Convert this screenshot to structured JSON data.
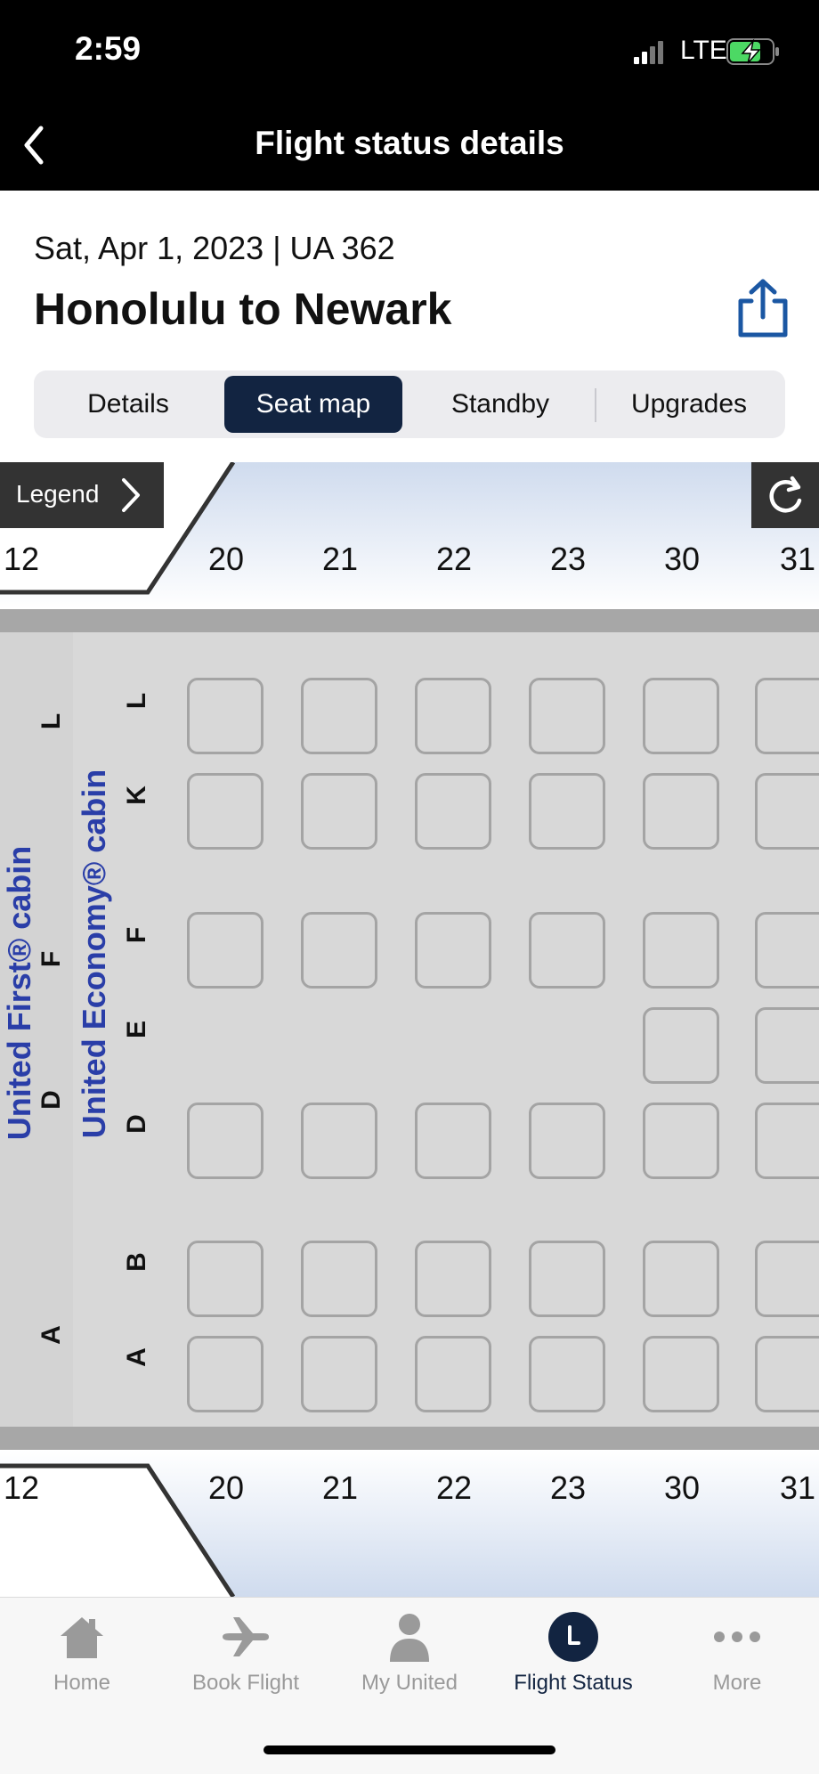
{
  "status_bar": {
    "time": "2:59",
    "network": "LTE"
  },
  "nav": {
    "title": "Flight status details",
    "back_icon": "chevron-left-icon"
  },
  "flight": {
    "date_line": "Sat, Apr 1, 2023 | UA 362",
    "route": "Honolulu to Newark",
    "share_icon": "share-icon"
  },
  "tabs": [
    {
      "label": "Details",
      "active": false
    },
    {
      "label": "Seat map",
      "active": true
    },
    {
      "label": "Standby",
      "active": false
    },
    {
      "label": "Upgrades",
      "active": false
    }
  ],
  "seat_map": {
    "legend_label": "Legend",
    "refresh_icon": "refresh-icon",
    "rows": [
      "12",
      "20",
      "21",
      "22",
      "23",
      "30",
      "31"
    ],
    "cabins": [
      {
        "name": "United First® cabin",
        "columns": [
          "L",
          "F",
          "D",
          "A"
        ]
      },
      {
        "name": "United Economy® cabin",
        "columns": [
          "L",
          "K",
          "F",
          "E",
          "D",
          "B",
          "A"
        ]
      }
    ],
    "seat_columns_by_row": {
      "20": [
        "L",
        "K",
        "F",
        "D",
        "B",
        "A"
      ],
      "21": [
        "L",
        "K",
        "F",
        "D",
        "B",
        "A"
      ],
      "22": [
        "L",
        "K",
        "F",
        "D",
        "B",
        "A"
      ],
      "23": [
        "L",
        "K",
        "F",
        "D",
        "B",
        "A"
      ],
      "30": [
        "L",
        "K",
        "F",
        "E",
        "D",
        "B",
        "A"
      ],
      "31": [
        "L",
        "K",
        "F",
        "E",
        "D",
        "B",
        "A"
      ]
    }
  },
  "bottom_nav": [
    {
      "label": "Home",
      "icon": "home-icon",
      "active": false
    },
    {
      "label": "Book Flight",
      "icon": "airplane-icon",
      "active": false
    },
    {
      "label": "My United",
      "icon": "person-icon",
      "active": false
    },
    {
      "label": "Flight Status",
      "icon": "flight-status-icon",
      "active": true
    },
    {
      "label": "More",
      "icon": "more-icon",
      "active": false
    }
  ],
  "colors": {
    "navy": "#122441",
    "cabin_label": "#2a3ea8",
    "header_gradient": "#cfdbee"
  }
}
